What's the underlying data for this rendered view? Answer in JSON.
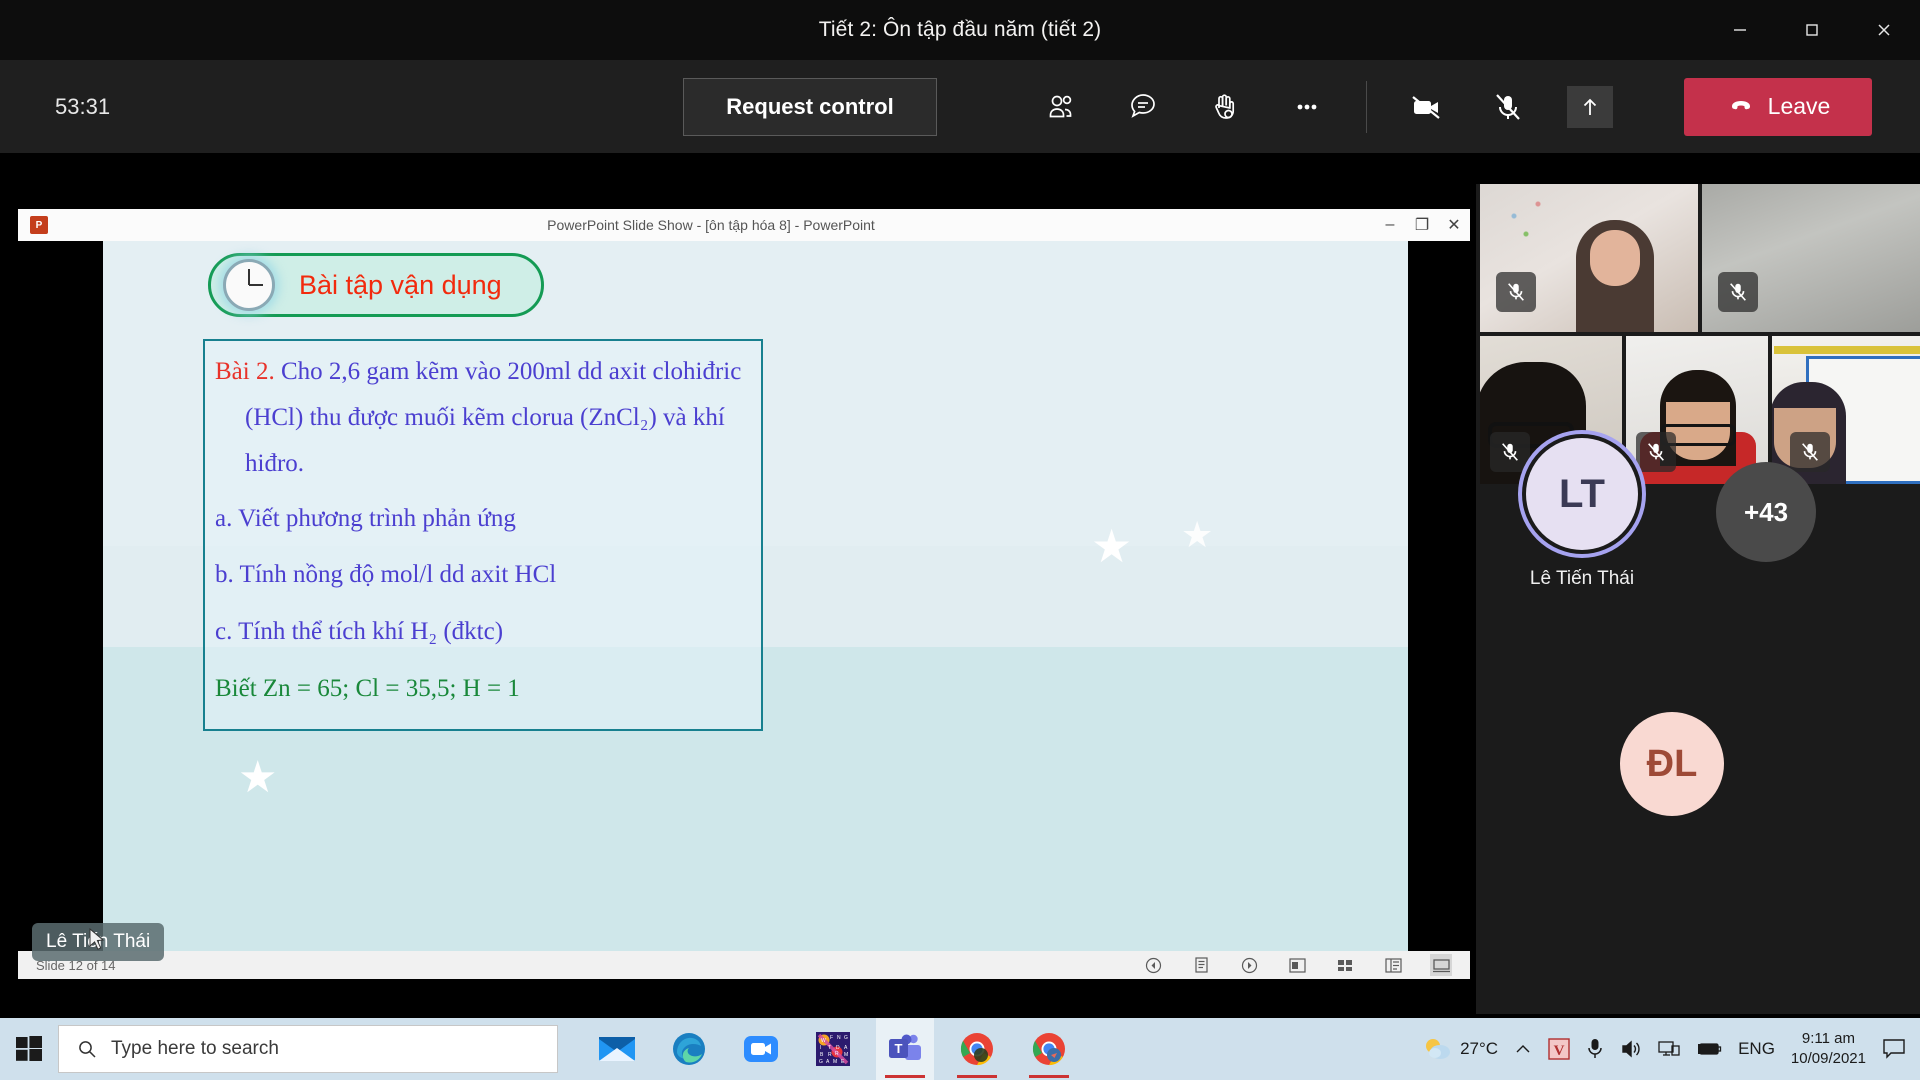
{
  "window": {
    "title": "Tiết 2: Ôn tập đầu năm (tiết 2)",
    "minimize_label": "Minimize",
    "maximize_label": "Maximize",
    "close_label": "Close"
  },
  "meeting_bar": {
    "timer": "53:31",
    "request_control_label": "Request control",
    "leave_label": "Leave",
    "icons": {
      "people": "people-icon",
      "chat": "chat-icon",
      "reactions": "raise-hand-icon",
      "more": "more-options-icon",
      "camera": "camera-off-icon",
      "mic": "mic-off-icon",
      "share": "share-tray-icon",
      "leave": "hang-up-icon"
    },
    "accent_leave": "#c4314b"
  },
  "powerpoint": {
    "title": "PowerPoint Slide Show - [ôn tập hóa 8] - PowerPoint",
    "app_icon_label": "P",
    "minimize_label": "–",
    "restore_label": "❐",
    "close_label": "✕",
    "status_text": "Slide 12 of 14",
    "presenter_chip": "Lê Tiến Thái",
    "status_icons": [
      "previous-slide-icon",
      "notes-icon",
      "next-slide-icon",
      "reading-view-icon",
      "slide-sorter-icon",
      "normal-view-icon",
      "slide-show-icon"
    ]
  },
  "slide": {
    "badge": {
      "text": "Bài tập vận dụng",
      "icon": "clock-icon",
      "text_color": "#f22a0d",
      "border_color": "#149b54",
      "fill_color": "#cfeee7"
    },
    "colors": {
      "body_text": "#4b3fd0",
      "heading_red": "#e8322a",
      "note_green": "#19883a",
      "box_border": "#17808f",
      "bg_top": "#e4eff3",
      "bg_bottom": "#cfe7ea"
    },
    "lines": [
      {
        "id": "l1",
        "prefix": "Bài 2.",
        "text": " Cho 2,6 gam kẽm vào 200ml dd axit clohiđric",
        "style": "red-prefix"
      },
      {
        "id": "l2",
        "text": "(HCl) thu được muối kẽm clorua (ZnCl₂) và khí",
        "style": "indent"
      },
      {
        "id": "l3",
        "text": "hiđro.",
        "style": "indent"
      },
      {
        "id": "l4",
        "text": "a.    Viết phương trình phản ứng",
        "style": "plain"
      },
      {
        "id": "l5",
        "text": "b. Tính nồng độ mol/l dd axit HCl",
        "style": "plain"
      },
      {
        "id": "l6",
        "text": "c. Tính thể tích khí H₂ (đktc)",
        "style": "plain"
      },
      {
        "id": "l7",
        "text": "Biết Zn = 65;  Cl = 35,5;  H = 1",
        "style": "green"
      }
    ]
  },
  "roster": {
    "video_tiles": [
      {
        "id": "tile-1",
        "mic_state": "muted"
      },
      {
        "id": "tile-2",
        "mic_state": "muted"
      },
      {
        "id": "tile-3",
        "mic_state": "muted"
      },
      {
        "id": "tile-4",
        "mic_state": "muted"
      },
      {
        "id": "tile-5",
        "mic_state": "muted"
      }
    ],
    "active_speaker": {
      "initials": "LT",
      "name": "Lê Tiến Thái",
      "ring_color": "#a6a3f0"
    },
    "overflow_count": "+43",
    "secondary_avatar": {
      "initials": "ĐL",
      "bg": "#f9d9d2",
      "fg": "#9e4a37"
    }
  },
  "taskbar": {
    "start_label": "Start",
    "search_placeholder": "Type here to search",
    "search_value": "",
    "apps": [
      {
        "name": "mail-app",
        "label": "Mail"
      },
      {
        "name": "edge-app",
        "label": "Microsoft Edge"
      },
      {
        "name": "zoom-app",
        "label": "Zoom"
      },
      {
        "name": "wordsearch-app",
        "label": "Word Search"
      },
      {
        "name": "teams-app",
        "label": "Microsoft Teams"
      },
      {
        "name": "chrome-app-1",
        "label": "Google Chrome"
      },
      {
        "name": "chrome-app-2",
        "label": "Google Chrome"
      }
    ],
    "tray": {
      "weather": "27°C",
      "chevron": "⌃",
      "unikey": "V",
      "language": "ENG",
      "time": "9:11 am",
      "date": "10/09/2021",
      "icons": [
        "weather-icon",
        "show-hidden-icons-icon",
        "unikey-icon",
        "microphone-icon",
        "volume-icon",
        "network-icon",
        "battery-icon",
        "notifications-icon"
      ]
    }
  }
}
